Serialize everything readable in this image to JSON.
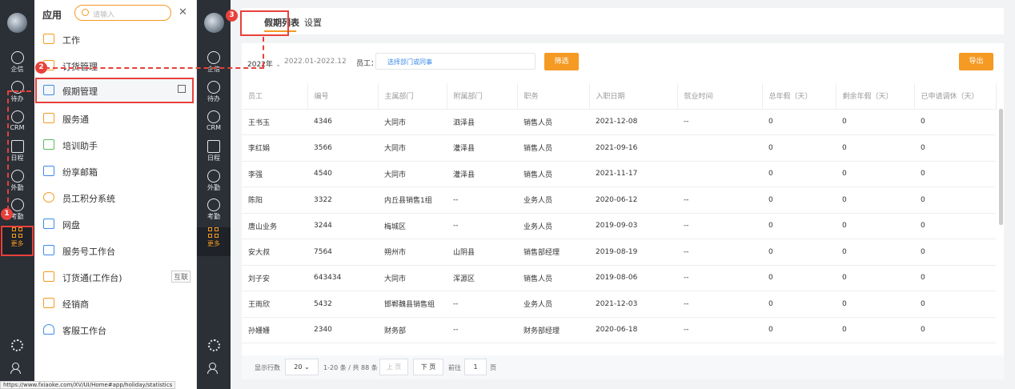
{
  "nav": {
    "items": [
      {
        "label": "企信",
        "icon": "chat-icon"
      },
      {
        "label": "待办",
        "icon": "check-circle-icon"
      },
      {
        "label": "CRM",
        "icon": "clock-icon"
      },
      {
        "label": "日程",
        "icon": "calendar-icon"
      },
      {
        "label": "外勤",
        "icon": "location-icon"
      },
      {
        "label": "考勤",
        "icon": "check-circle-icon"
      },
      {
        "label": "更多",
        "icon": "grid-icon"
      }
    ]
  },
  "drawer": {
    "title": "应用",
    "search_placeholder": "请输入",
    "apps": [
      {
        "label": "工作",
        "icon": "work-icon"
      },
      {
        "label": "订货管理",
        "icon": "order-icon"
      },
      {
        "label": "假期管理",
        "icon": "holiday-icon"
      },
      {
        "label": "服务通",
        "icon": "service-icon"
      },
      {
        "label": "培训助手",
        "icon": "book-icon"
      },
      {
        "label": "纷享邮箱",
        "icon": "mail-icon"
      },
      {
        "label": "员工积分系统",
        "icon": "coins-icon"
      },
      {
        "label": "网盘",
        "icon": "disk-icon"
      },
      {
        "label": "服务号工作台",
        "icon": "monitor-icon"
      },
      {
        "label": "订货通(工作台)",
        "icon": "order-desk-icon",
        "tag": "互联"
      },
      {
        "label": "经销商",
        "icon": "dealer-icon"
      },
      {
        "label": "客服工作台",
        "icon": "headset-icon"
      }
    ]
  },
  "tabs": [
    "假期列表",
    "设置"
  ],
  "filter": {
    "year": "2022年",
    "range": "2022.01-2022.12",
    "employee_label": "员工：",
    "employee_placeholder": "选择部门或同事",
    "filter_button": "筛选",
    "export_button": "导出"
  },
  "table": {
    "columns": [
      "员工",
      "编号",
      "主属部门",
      "附属部门",
      "职务",
      "入职日期",
      "就业时间",
      "总年假（天）",
      "剩余年假（天）",
      "已申请调休（天）"
    ],
    "rows": [
      [
        "王书玉",
        "4346",
        "大同市",
        "泗泽县",
        "销售人员",
        "2021-12-08",
        "--",
        "0",
        "0",
        "0"
      ],
      [
        "李红娟",
        "3566",
        "大同市",
        "灌泽县",
        "销售人员",
        "2021-09-16",
        "",
        "0",
        "0",
        "0"
      ],
      [
        "李强",
        "4540",
        "大同市",
        "灌泽县",
        "销售人员",
        "2021-11-17",
        "",
        "0",
        "0",
        "0"
      ],
      [
        "陈阳",
        "3322",
        "内丘县销售1组",
        "--",
        "业务人员",
        "2020-06-12",
        "--",
        "0",
        "0",
        "0"
      ],
      [
        "唐山业务",
        "3244",
        "梅城区",
        "--",
        "业务人员",
        "2019-09-03",
        "--",
        "0",
        "0",
        "0"
      ],
      [
        "安大叔",
        "7564",
        "朔州市",
        "山阴县",
        "销售部经理",
        "2019-08-19",
        "--",
        "0",
        "0",
        "0"
      ],
      [
        "刘子安",
        "643434",
        "大同市",
        "浑源区",
        "销售人员",
        "2019-08-06",
        "--",
        "0",
        "0",
        "0"
      ],
      [
        "王雨欣",
        "5432",
        "邯郸魏县销售组",
        "--",
        "业务人员",
        "2021-12-03",
        "--",
        "0",
        "0",
        "0"
      ],
      [
        "孙姗姗",
        "2340",
        "财务部",
        "--",
        "财务部经理",
        "2020-06-18",
        "--",
        "0",
        "0",
        "0"
      ]
    ]
  },
  "pager": {
    "rows_label": "显示行数",
    "page_size": "20",
    "summary": "1-20 条 / 共 88 条",
    "prev": "上 页",
    "next": "下 页",
    "goto_label": "前往",
    "page": "1",
    "page_unit": "页"
  },
  "status_url": "https://www.fxiaoke.com/XV/UI/Home#app/holiday/statistics",
  "callouts": [
    "1",
    "2",
    "3"
  ],
  "colors": {
    "accent": "#f59a23",
    "nav_bg": "#2b2f36",
    "callout": "#e8413b",
    "link": "#3d8be8"
  }
}
